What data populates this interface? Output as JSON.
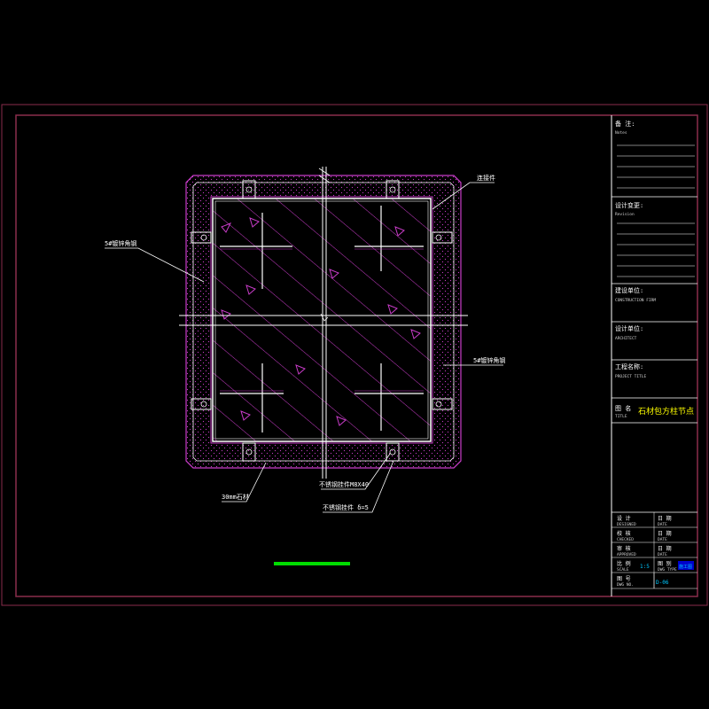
{
  "colors": {
    "background": "#000000",
    "frame": "#8a2d4c",
    "outline_white": "#ffffff",
    "hatch_magenta": "#c83cc8",
    "highlight_yellow": "#ffff00",
    "highlight_cyan": "#00c8ff",
    "scale_bar_green": "#00dd00"
  },
  "title_block": {
    "remarks_label": "备 注:",
    "remarks_en": "Notes",
    "revision_label": "设计变更:",
    "revision_en": "Revision",
    "construction_label": "建设单位:",
    "construction_en": "CONSTRUCTION FIRM",
    "architect_label": "设计单位:",
    "architect_en": "ARCHITECT",
    "project_label": "工程名称:",
    "project_en": "PROJECT TITLE",
    "drawing_name_label": "图 名",
    "drawing_name_en": "TITLE",
    "drawing_title": "石材包方柱节点",
    "sig_rows": [
      {
        "label": "设 计",
        "en": "DESIGNED",
        "date": "日 期",
        "date_en": "DATE"
      },
      {
        "label": "校 核",
        "en": "CHECKED",
        "date": "日 期",
        "date_en": "DATE"
      },
      {
        "label": "审 核",
        "en": "APPROVED",
        "date": "日 期",
        "date_en": "DATE"
      },
      {
        "label": "比 例",
        "en": "SCALE",
        "date": "图 别",
        "date_en": "DWG TYPE"
      }
    ],
    "scale_value": "1:5",
    "dwg_type_value": "施工图",
    "sheet_label": "图 号",
    "sheet_en": "DWG NO.",
    "sheet_value": "D-06"
  },
  "annotations": {
    "connector": "连接件",
    "stone_left": "5#镀锌角钢",
    "stone_right": "5#镀锌角钢",
    "stone_thickness": "30mm石材",
    "bolt": "不锈钢挂件M8X40",
    "plate": "不锈钢挂件 δ=5"
  }
}
